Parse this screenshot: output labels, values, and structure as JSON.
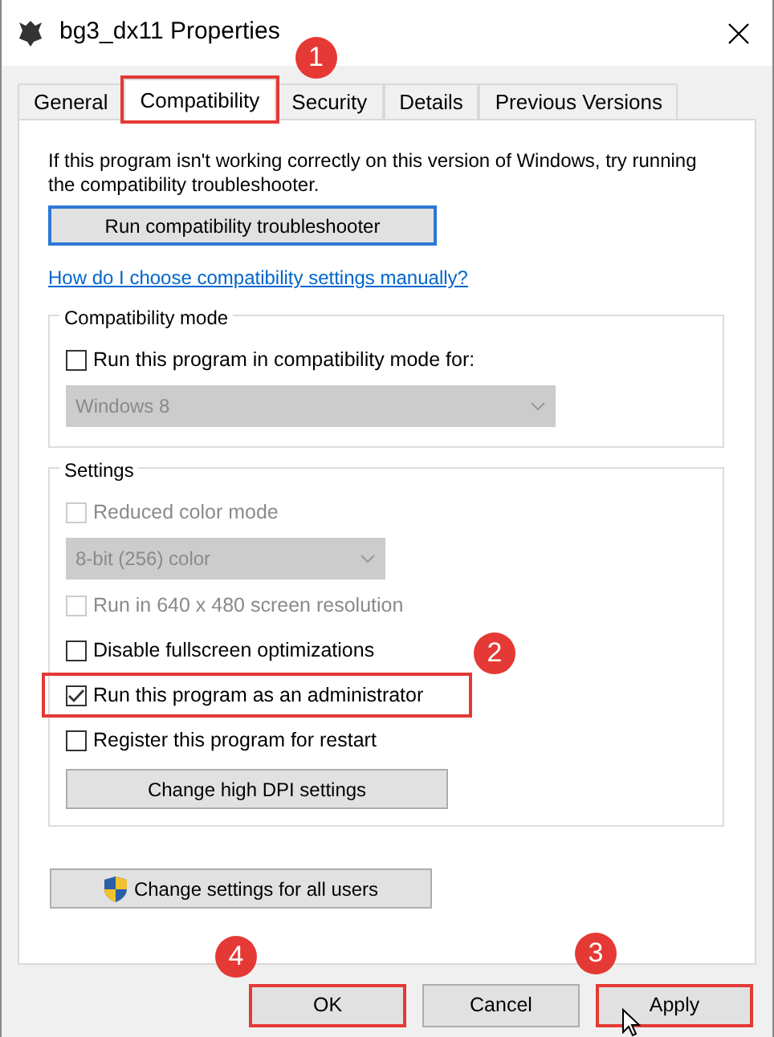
{
  "window": {
    "title": "bg3_dx11 Properties"
  },
  "tabs": [
    {
      "label": "General",
      "selected": false,
      "highlighted": false
    },
    {
      "label": "Compatibility",
      "selected": true,
      "highlighted": true,
      "callout": "1"
    },
    {
      "label": "Security",
      "selected": false,
      "highlighted": false
    },
    {
      "label": "Details",
      "selected": false,
      "highlighted": false
    },
    {
      "label": "Previous Versions",
      "selected": false,
      "highlighted": false
    }
  ],
  "intro": "If this program isn't working correctly on this version of Windows, try running the compatibility troubleshooter.",
  "troubleshooter_button": "Run compatibility troubleshooter",
  "help_link": "How do I choose compatibility settings manually?",
  "compatibility_mode": {
    "title": "Compatibility mode",
    "items": [
      {
        "kind": "checkbox",
        "label": "Run this program in compatibility mode for:",
        "checked": false,
        "disabled": false,
        "highlighted": false
      },
      {
        "kind": "dropdown",
        "value": "Windows 8",
        "disabled": true
      }
    ]
  },
  "settings": {
    "title": "Settings",
    "items": [
      {
        "kind": "checkbox",
        "label": "Reduced color mode",
        "checked": false,
        "disabled": true,
        "highlighted": false
      },
      {
        "kind": "dropdown",
        "value": "8-bit (256) color",
        "disabled": true
      },
      {
        "kind": "checkbox",
        "label": "Run in 640 x 480 screen resolution",
        "checked": false,
        "disabled": true,
        "highlighted": false
      },
      {
        "kind": "checkbox",
        "label": "Disable fullscreen optimizations",
        "checked": false,
        "disabled": false,
        "highlighted": false
      },
      {
        "kind": "checkbox",
        "label": "Run this program as an administrator",
        "checked": true,
        "disabled": false,
        "highlighted": true,
        "callout": "2"
      },
      {
        "kind": "checkbox",
        "label": "Register this program for restart",
        "checked": false,
        "disabled": false,
        "highlighted": false
      },
      {
        "kind": "button",
        "label": "Change high DPI settings"
      }
    ]
  },
  "all_users_button": "Change settings for all users",
  "buttons": [
    {
      "label": "OK",
      "highlighted": true,
      "callout": "4"
    },
    {
      "label": "Cancel",
      "highlighted": false
    },
    {
      "label": "Apply",
      "highlighted": true,
      "callout": "3"
    }
  ]
}
